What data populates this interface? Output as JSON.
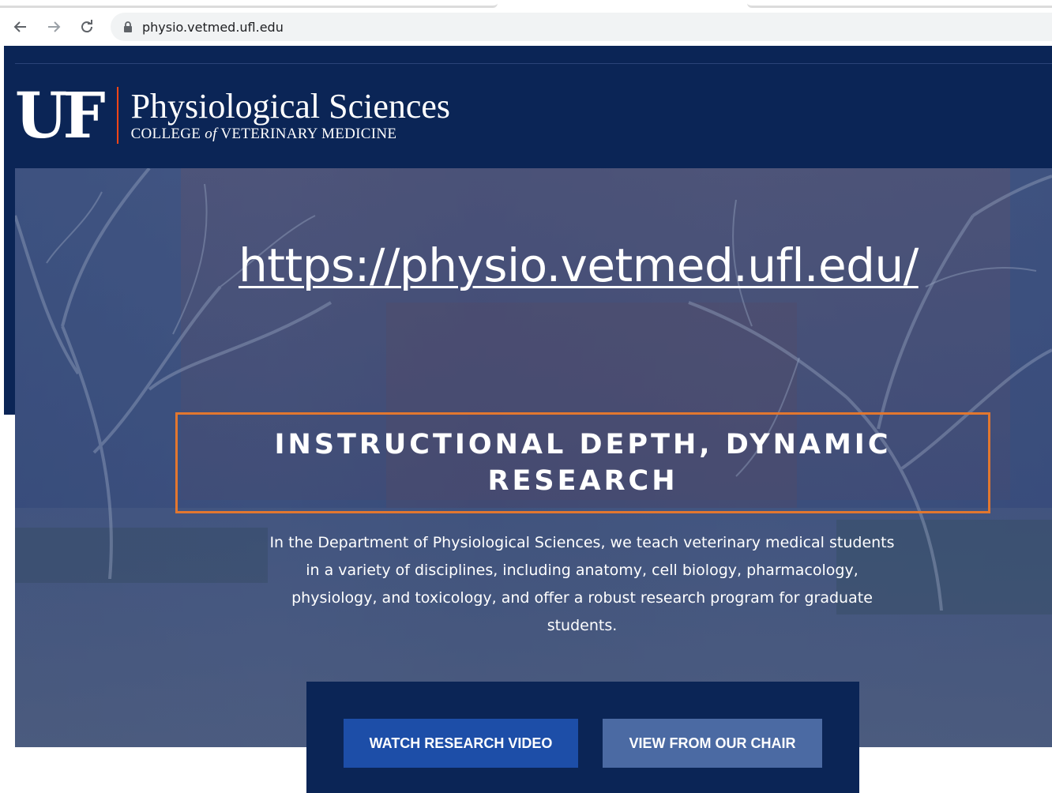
{
  "browser": {
    "url": "physio.vetmed.ufl.edu",
    "back_icon": "back-arrow-icon",
    "forward_icon": "forward-arrow-icon",
    "reload_icon": "reload-icon",
    "lock_icon": "lock-icon"
  },
  "header": {
    "logo_mark": "UF",
    "site_title": "Physiological Sciences",
    "college_pre": "COLLEGE ",
    "college_of": "of",
    "college_post": " VETERINARY MEDICINE"
  },
  "hero": {
    "overlay_link": "https://physio.vetmed.ufl.edu/",
    "headline": "INSTRUCTIONAL DEPTH, DYNAMIC RESEARCH",
    "intro": "In the Department of Physiological Sciences, we teach veterinary medical students in a variety of disciplines, including anatomy, cell biology, pharmacology, physiology, and toxicology, and offer a robust research program for graduate students."
  },
  "cta": {
    "primary_label": "WATCH RESEARCH VIDEO",
    "secondary_label": "VIEW FROM OUR CHAIR"
  },
  "colors": {
    "navy": "#0b2556",
    "uf_orange": "#fa4616",
    "box_orange": "#e2772f",
    "button_primary": "#1d4ea8",
    "button_secondary": "#4b6aa3"
  }
}
